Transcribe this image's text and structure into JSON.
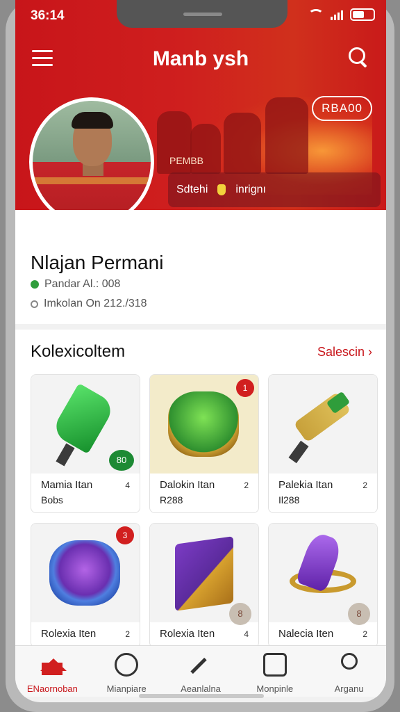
{
  "status": {
    "time": "36:14"
  },
  "header": {
    "title": "Manb ysh"
  },
  "hero": {
    "pill_label": "RBA00",
    "caption": "PEMBB",
    "bar_left": "Sdtehi",
    "bar_right": "inrignı"
  },
  "profile": {
    "name": "Nlajan Permani",
    "line1": "Pandar Al.: 008",
    "line2": "Imkolan On 212./318"
  },
  "collection": {
    "title": "Kolexicoltem",
    "see_all": "Salescin ›",
    "items": [
      {
        "label": "Mamia Itan",
        "sub": "Bobs",
        "count": "4",
        "badge": "80"
      },
      {
        "label": "Dalokin Itan",
        "sub": "R288",
        "count": "2",
        "badge": "1"
      },
      {
        "label": "Palekia Itan",
        "sub": "Il288",
        "count": "2",
        "badge": ""
      },
      {
        "label": "Rolexia Iten",
        "sub": "",
        "count": "2",
        "badge": "3"
      },
      {
        "label": "Rolexia Iten",
        "sub": "",
        "count": "4",
        "badge": "8"
      },
      {
        "label": "Nalecia Iten",
        "sub": "",
        "count": "2",
        "badge": "8"
      }
    ]
  },
  "tabs": [
    {
      "label": "ENaornoban",
      "icon": "home-icon",
      "active": true
    },
    {
      "label": "Mianpiare",
      "icon": "stats-icon"
    },
    {
      "label": "Aeanlalna",
      "icon": "edit-icon"
    },
    {
      "label": "Monpinle",
      "icon": "inbox-icon"
    },
    {
      "label": "Arganu",
      "icon": "user-icon"
    }
  ],
  "colors": {
    "brand_red": "#c8151a",
    "accent_green": "#2f9d3b"
  }
}
